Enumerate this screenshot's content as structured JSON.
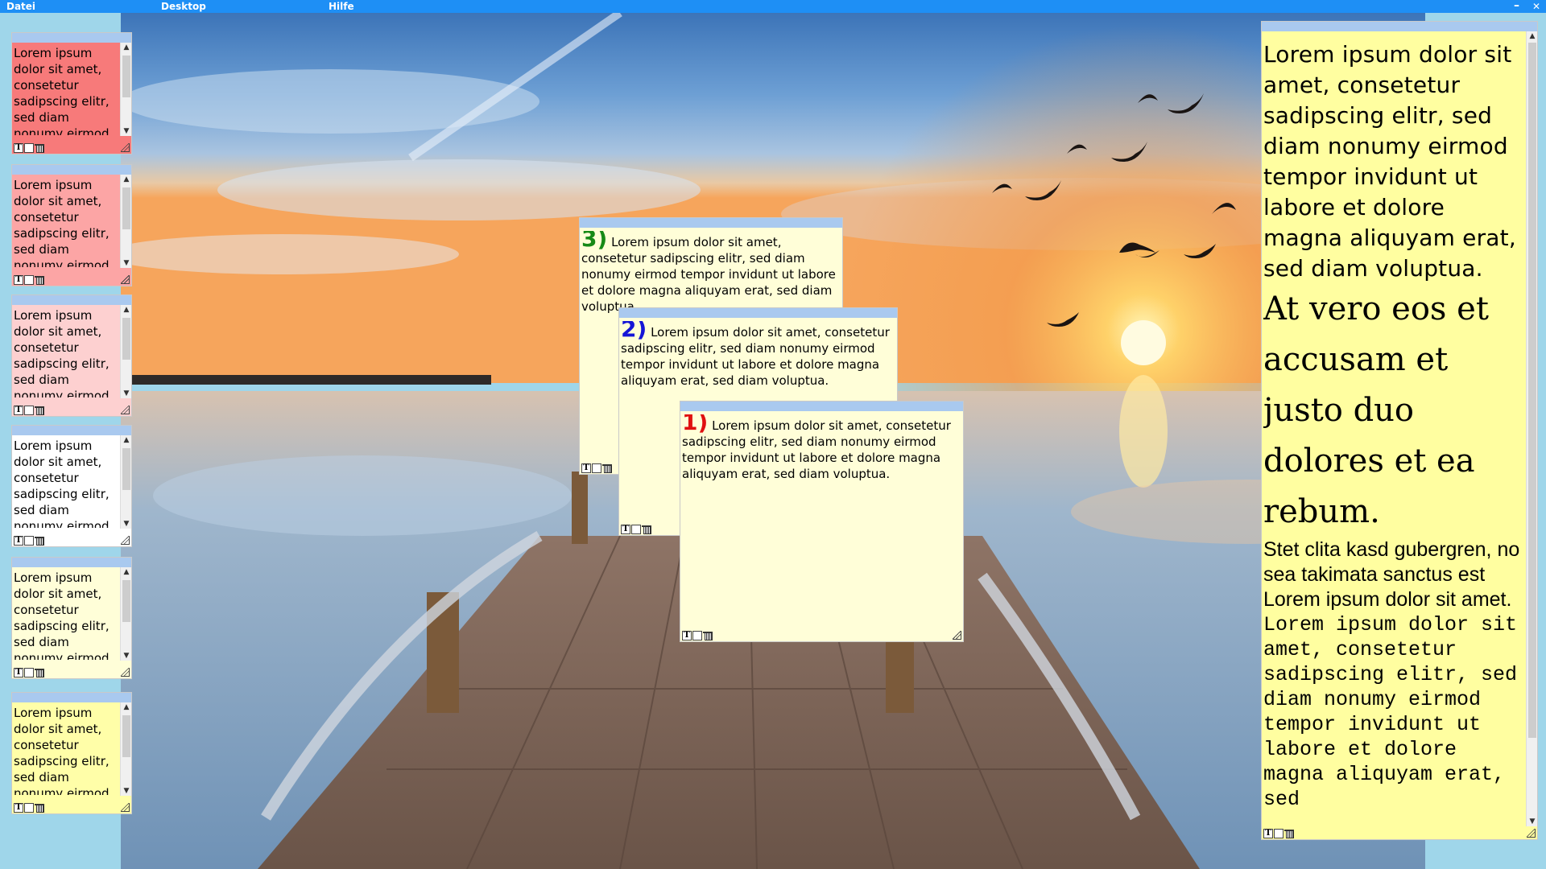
{
  "menubar": {
    "items": [
      "Datei",
      "Desktop",
      "Hilfe"
    ],
    "minimize_glyph": "–",
    "close_glyph": "✕"
  },
  "colors": {
    "menubar": "#1e8ff5",
    "note_titlebar": "#a9c9ef",
    "note_yellow": "#fffed8",
    "big_note_yellow": "#fffea0",
    "red_1": "#f77a7a",
    "red_2": "#fca5a5",
    "red_3": "#fdd0d0",
    "white": "#ffffff",
    "yellow_light": "#fffed8",
    "yellow_mid": "#fffea8",
    "num_green": "#168a16",
    "num_blue": "#1515d6",
    "num_red": "#e01010"
  },
  "footer_icons": [
    "text-format-icon",
    "color-swatch-icon",
    "trash-icon"
  ],
  "footer_text_glyph": "T",
  "sidebar_notes": [
    {
      "text": "Lorem ipsum dolor sit amet, consetetur sadipscing elitr, sed diam nonumy eirmod tempor",
      "color": "#f77a7a"
    },
    {
      "text": "Lorem ipsum dolor sit amet, consetetur sadipscing elitr, sed diam nonumy eirmod tempor",
      "color": "#fca5a5"
    },
    {
      "text": "Lorem ipsum dolor sit amet, consetetur sadipscing elitr, sed diam nonumy eirmod tempor",
      "color": "#fdd0d0"
    },
    {
      "text": "Lorem ipsum dolor sit amet, consetetur sadipscing elitr, sed diam nonumy eirmod tempor",
      "color": "#ffffff"
    },
    {
      "text": "Lorem ipsum dolor sit amet, consetetur sadipscing elitr, sed diam nonumy eirmod tempor",
      "color": "#fffed8"
    },
    {
      "text": "Lorem ipsum dolor sit amet, consetetur sadipscing elitr, sed diam nonumy eirmod tempor",
      "color": "#fffea8"
    }
  ],
  "stack_notes": [
    {
      "number": "3)",
      "number_color": "#168a16",
      "text": "Lorem ipsum dolor sit amet, consetetur sadipscing elitr, sed diam nonumy eirmod tempor invidunt ut labore et dolore magna aliquyam erat, sed diam voluptua."
    },
    {
      "number": "2)",
      "number_color": "#1515d6",
      "text": "Lorem ipsum dolor sit amet, consetetur sadipscing elitr, sed diam nonumy eirmod tempor invidunt ut labore et dolore magna aliquyam erat, sed diam voluptua."
    },
    {
      "number": "1)",
      "number_color": "#e01010",
      "text": "Lorem ipsum dolor sit amet, consetetur sadipscing elitr, sed diam nonumy eirmod tempor invidunt ut labore et dolore magna aliquyam erat, sed diam voluptua."
    }
  ],
  "big_note": {
    "paragraph_1": "Lorem ipsum dolor sit amet, consetetur sadipscing elitr, sed diam nonumy eirmod tempor invidunt ut labore et dolore magna aliquyam erat, sed diam voluptua.",
    "paragraph_2": "At vero eos et accusam et justo duo dolores et ea rebum.",
    "paragraph_3": "Stet clita kasd gubergren, no sea takimata sanctus est Lorem ipsum dolor sit amet.",
    "paragraph_4": "Lorem ipsum dolor sit amet, consetetur sadipscing elitr, sed diam nonumy eirmod tempor invidunt ut labore et dolore magna aliquyam erat, sed"
  }
}
